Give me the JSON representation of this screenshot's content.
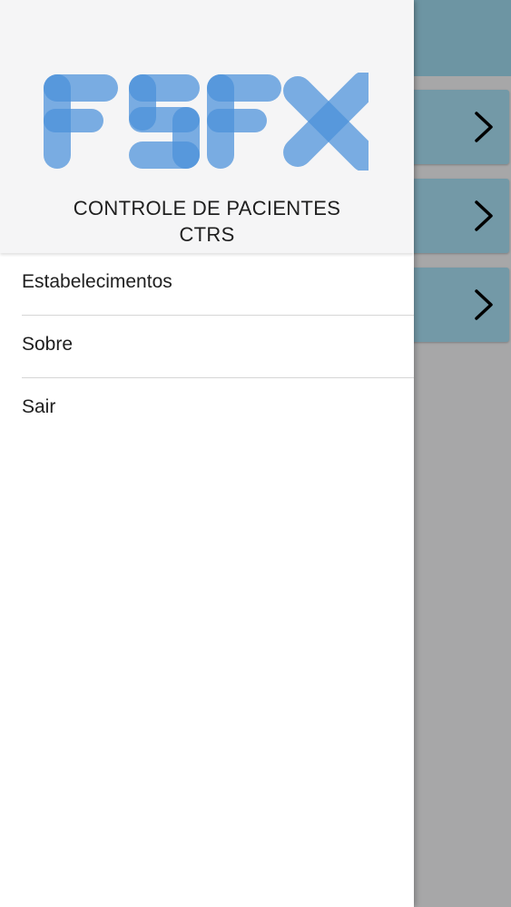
{
  "header": {
    "logo_text": "FSFX",
    "title": "CONTROLE DE PACIENTES",
    "subtitle": "CTRS"
  },
  "menu": {
    "items": [
      {
        "label": "Estabelecimentos"
      },
      {
        "label": "Sobre"
      },
      {
        "label": "Sair"
      }
    ]
  },
  "background_list": {
    "rows": [
      {
        "icon": "chevron-right-icon"
      },
      {
        "icon": "chevron-right-icon"
      },
      {
        "icon": "chevron-right-icon"
      }
    ]
  },
  "colors": {
    "logo_blue": "#4a90d9",
    "toolbar": "#6d95a3",
    "row": "#7399a7",
    "scrim": "#a7a7a8"
  }
}
